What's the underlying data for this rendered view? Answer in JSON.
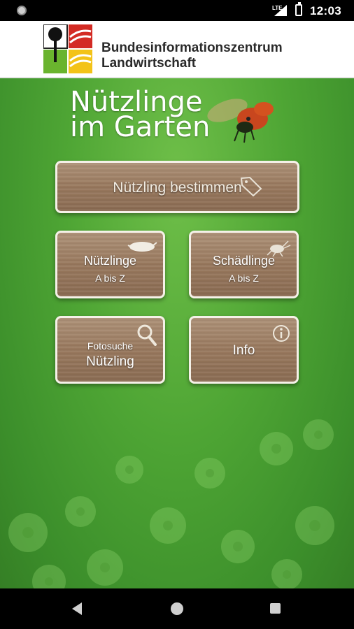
{
  "status": {
    "network": "LTE",
    "time": "12:03"
  },
  "header": {
    "org_line1": "Bundesinformationszentrum",
    "org_line2": "Landwirtschaft"
  },
  "app": {
    "title_line1": "Nützlinge",
    "title_line2": "im Garten"
  },
  "buttons": {
    "bestimmen": "Nützling bestimmen",
    "nuetzlinge": {
      "line1": "Nützlinge",
      "line2": "A bis Z"
    },
    "schaedlinge": {
      "line1": "Schädlinge",
      "line2": "A bis Z"
    },
    "fotosuche": {
      "line1": "Fotosuche",
      "line2": "Nützling"
    },
    "info": "Info"
  },
  "colors": {
    "green": "#4ea534",
    "wood": "#98785d",
    "logo_red": "#d32b24",
    "logo_green": "#6ab42e",
    "logo_yellow": "#f3c318"
  },
  "icons": [
    "tag-icon",
    "larva-icon",
    "insect-icon",
    "magnifier-icon",
    "info-icon",
    "ladybug-icon"
  ]
}
